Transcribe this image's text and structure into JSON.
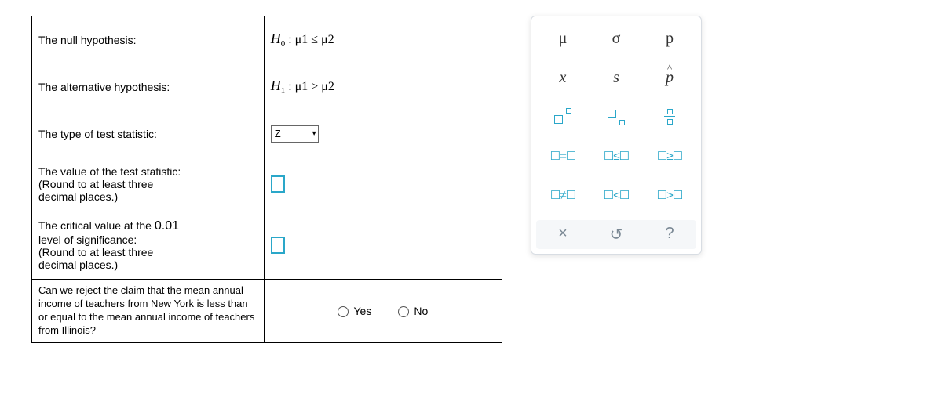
{
  "rows": {
    "null_label": "The null hypothesis:",
    "null_value_prefix": "H",
    "null_value_sub": "0",
    "null_value_body": " : μ1 ≤ μ2",
    "alt_label": "The alternative hypothesis:",
    "alt_value_prefix": "H",
    "alt_value_sub": "1",
    "alt_value_body": " : μ1 > μ2",
    "type_label": "The type of test statistic:",
    "type_selected": "Z",
    "value_label_l1": "The value of the test statistic:",
    "value_label_l2": "(Round to at least three",
    "value_label_l3": "decimal places.)",
    "crit_label_l1_a": "The critical value at the ",
    "crit_label_l1_b": "0.01",
    "crit_label_l2": "level of significance:",
    "crit_label_l3": "(Round to at least three",
    "crit_label_l4": "decimal places.)"
  },
  "question": {
    "text": "Can we reject the claim that the mean annual income of teachers from New York is less than or equal to the mean annual income of teachers from Illinois?",
    "yes": "Yes",
    "no": "No"
  },
  "palette": {
    "r1": [
      "μ",
      "σ",
      "p"
    ],
    "r2_xbar": "x",
    "r2_s": "s",
    "r2_phat": "p",
    "r4": [
      "☐=☐",
      "☐≤☐",
      "☐≥☐"
    ],
    "r5": [
      "☐≠☐",
      "☐<☐",
      "☐>☐"
    ],
    "ctrl": [
      "×",
      "↺",
      "?"
    ]
  }
}
